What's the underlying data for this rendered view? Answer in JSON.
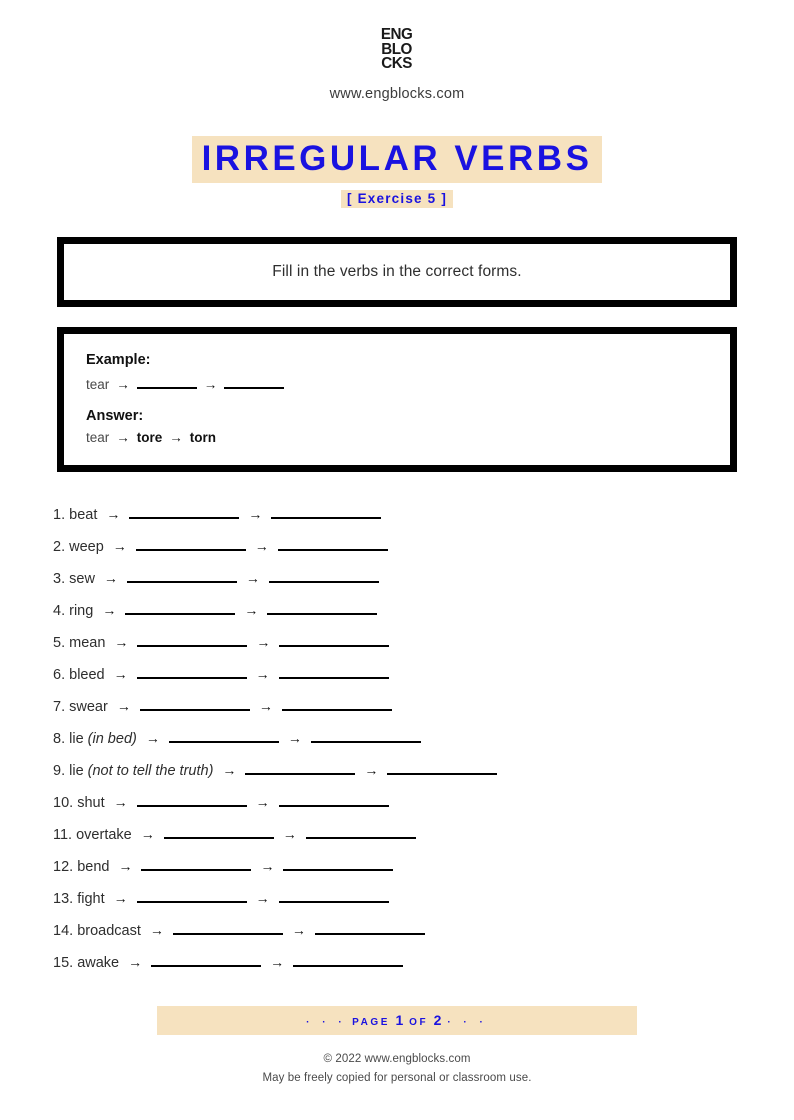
{
  "header": {
    "logo_lines": [
      "ENG",
      "BLO",
      "CKS"
    ],
    "site_url": "www.engblocks.com"
  },
  "title": {
    "main": "IRREGULAR VERBS",
    "subtitle": "[ Exercise 5 ]",
    "highlight_color": "#f6e2bf",
    "text_color": "#1a12e0"
  },
  "instruction": {
    "text": "Fill in the verbs in the correct forms."
  },
  "example": {
    "example_label": "Example:",
    "example_verb": "tear",
    "answer_label": "Answer:",
    "answer_verb": "tear",
    "answer_past": "tore",
    "answer_participle": "torn",
    "arrow": "→"
  },
  "exercise": {
    "arrow": "→",
    "items": [
      {
        "number": "1.",
        "verb": "beat",
        "note": ""
      },
      {
        "number": "2.",
        "verb": "weep",
        "note": ""
      },
      {
        "number": "3.",
        "verb": "sew",
        "note": ""
      },
      {
        "number": "4.",
        "verb": "ring",
        "note": ""
      },
      {
        "number": "5.",
        "verb": "mean",
        "note": ""
      },
      {
        "number": "6.",
        "verb": "bleed",
        "note": ""
      },
      {
        "number": "7.",
        "verb": "swear",
        "note": ""
      },
      {
        "number": "8.",
        "verb": "lie",
        "note": "(in bed)"
      },
      {
        "number": "9.",
        "verb": "lie",
        "note": "(not to tell the truth)"
      },
      {
        "number": "10.",
        "verb": "shut",
        "note": ""
      },
      {
        "number": "11.",
        "verb": "overtake",
        "note": ""
      },
      {
        "number": "12.",
        "verb": "bend",
        "note": ""
      },
      {
        "number": "13.",
        "verb": "fight",
        "note": ""
      },
      {
        "number": "14.",
        "verb": "broadcast",
        "note": ""
      },
      {
        "number": "15.",
        "verb": "awake",
        "note": ""
      }
    ]
  },
  "footer": {
    "dots_left": "·  ·  ·",
    "page_word": "PAGE",
    "page_current": "1",
    "of_word": "OF",
    "page_total": "2",
    "dots_right": "·  ·  ·",
    "copyright": "© 2022 www.engblocks.com",
    "license": "May be freely copied for personal or classroom use."
  }
}
